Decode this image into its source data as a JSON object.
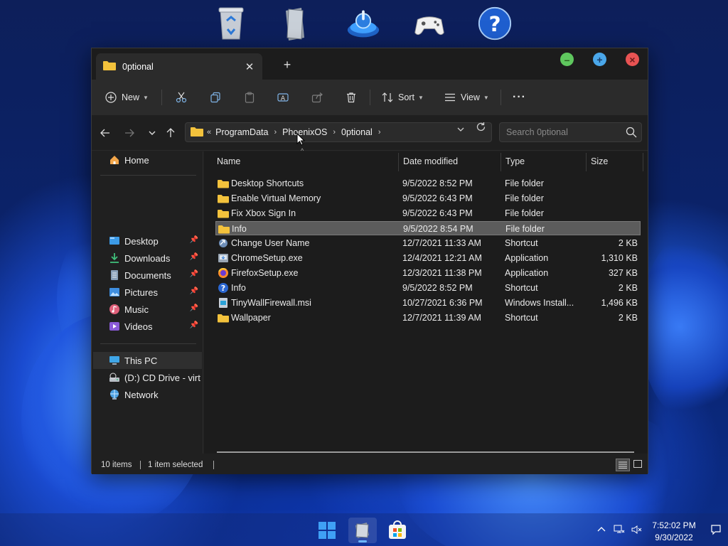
{
  "desktop": {
    "top_icons": [
      "recycle-bin-icon",
      "documents-icon",
      "power-icon",
      "xbox-controller-icon",
      "help-icon"
    ]
  },
  "window": {
    "tab_title": "0ptional",
    "new_tab_symbol": "+",
    "close_tab_symbol": "✕"
  },
  "toolbar": {
    "new_label": "New",
    "sort_label": "Sort",
    "view_label": "View",
    "more_label": "···"
  },
  "address": {
    "overflow": "«",
    "crumbs": [
      "ProgramData",
      "PhoenixOS",
      "0ptional"
    ]
  },
  "search": {
    "placeholder": "Search 0ptional"
  },
  "nav": {
    "items": [
      {
        "label": "Home",
        "icon": "home-icon",
        "pinned": false
      },
      {
        "label": "Desktop",
        "icon": "desktop-icon",
        "pinned": true
      },
      {
        "label": "Downloads",
        "icon": "downloads-icon",
        "pinned": true
      },
      {
        "label": "Documents",
        "icon": "documents-icon",
        "pinned": true
      },
      {
        "label": "Pictures",
        "icon": "pictures-icon",
        "pinned": true
      },
      {
        "label": "Music",
        "icon": "music-icon",
        "pinned": true
      },
      {
        "label": "Videos",
        "icon": "videos-icon",
        "pinned": true
      },
      {
        "label": "This PC",
        "icon": "this-pc-icon",
        "pinned": false
      },
      {
        "label": "(D:) CD Drive - virt",
        "icon": "cd-drive-icon",
        "pinned": false
      },
      {
        "label": "Network",
        "icon": "network-icon",
        "pinned": false
      }
    ]
  },
  "columns": {
    "name": "Name",
    "date": "Date modified",
    "type": "Type",
    "size": "Size"
  },
  "files": [
    {
      "name": "Desktop Shortcuts",
      "date": "9/5/2022 8:52 PM",
      "type": "File folder",
      "size": "",
      "icon": "folder-icon",
      "selected": false
    },
    {
      "name": "Enable Virtual Memory",
      "date": "9/5/2022 6:43 PM",
      "type": "File folder",
      "size": "",
      "icon": "folder-icon",
      "selected": false
    },
    {
      "name": "Fix Xbox Sign In",
      "date": "9/5/2022 6:43 PM",
      "type": "File folder",
      "size": "",
      "icon": "folder-icon",
      "selected": false
    },
    {
      "name": "Info",
      "date": "9/5/2022 8:54 PM",
      "type": "File folder",
      "size": "",
      "icon": "folder-icon",
      "selected": true
    },
    {
      "name": "Change User Name",
      "date": "12/7/2021 11:33 AM",
      "type": "Shortcut",
      "size": "2 KB",
      "icon": "shortcut-icon",
      "selected": false
    },
    {
      "name": "ChromeSetup.exe",
      "date": "12/4/2021 12:21 AM",
      "type": "Application",
      "size": "1,310 KB",
      "icon": "installer-icon",
      "selected": false
    },
    {
      "name": "FirefoxSetup.exe",
      "date": "12/3/2021 11:38 PM",
      "type": "Application",
      "size": "327 KB",
      "icon": "firefox-icon",
      "selected": false
    },
    {
      "name": "Info",
      "date": "9/5/2022 8:52 PM",
      "type": "Shortcut",
      "size": "2 KB",
      "icon": "help-icon",
      "selected": false
    },
    {
      "name": "TinyWallFirewall.msi",
      "date": "10/27/2021 6:36 PM",
      "type": "Windows Install...",
      "size": "1,496 KB",
      "icon": "msi-icon",
      "selected": false
    },
    {
      "name": "Wallpaper",
      "date": "12/7/2021 11:39 AM",
      "type": "Shortcut",
      "size": "2 KB",
      "icon": "folder-icon",
      "selected": false
    }
  ],
  "status": {
    "count": "10 items",
    "selection": "1 item selected"
  },
  "taskbar": {
    "apps": [
      "start-icon",
      "file-explorer-icon",
      "store-icon"
    ],
    "time": "7:52:02 PM",
    "date": "9/30/2022"
  },
  "colors": {
    "folder": "#f3c23c",
    "selected_row": "#5c5c5c",
    "accent": "#4aa7ea"
  }
}
